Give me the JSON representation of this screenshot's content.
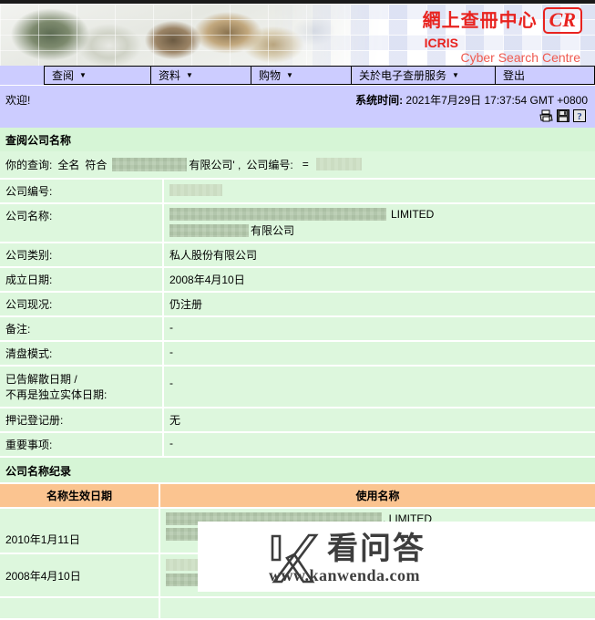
{
  "branding": {
    "logo_cn": "網上查冊中心",
    "logo_mark": "CR",
    "logo_icris": "ICRIS",
    "logo_subtitle": "Cyber Search Centre"
  },
  "menu": {
    "items": [
      {
        "label": "查阅",
        "has_caret": true
      },
      {
        "label": "资料",
        "has_caret": true
      },
      {
        "label": "购物",
        "has_caret": true
      },
      {
        "label": "关於电子查册服务",
        "has_caret": true
      },
      {
        "label": "登出",
        "has_caret": false
      }
    ],
    "caret_glyph": "▼"
  },
  "statusbar": {
    "welcome": "欢迎!",
    "system_time_label": "系统时间:",
    "system_time_value": "2021年7月29日 17:37:54 GMT +0800",
    "icons": [
      "printer-icon",
      "save-icon",
      "help-icon"
    ]
  },
  "query_section": {
    "title": "查阅公司名称",
    "query_lead": "你的查询:",
    "query_mode": "全名",
    "query_match_word": "符合",
    "query_name_redacted": "",
    "query_name_suffix": "有限公司' ,",
    "company_no_label": "公司编号:",
    "equals": "="
  },
  "details": {
    "rows": [
      {
        "label": "公司编号:",
        "value": "",
        "redacted": true
      },
      {
        "label": "公司名称:",
        "value": "LIMITED",
        "value2": "有限公司",
        "redacted": true
      },
      {
        "label": "公司类别:",
        "value": "私人股份有限公司",
        "redacted": false
      },
      {
        "label": "成立日期:",
        "value": "2008年4月10日",
        "redacted": false
      },
      {
        "label": "公司现况:",
        "value": "仍注册",
        "redacted": false
      },
      {
        "label": "备注:",
        "value": "-",
        "redacted": false
      },
      {
        "label": "清盘模式:",
        "value": "-",
        "redacted": false
      },
      {
        "label": "已告解散日期 /",
        "label2": "不再是独立实体日期:",
        "value": "-",
        "redacted": false
      },
      {
        "label": "押记登记册:",
        "value": "无",
        "redacted": false
      },
      {
        "label": "重要事项:",
        "value": "-",
        "redacted": false
      }
    ]
  },
  "history_section": {
    "title": "公司名称纪录",
    "columns": [
      "名称生效日期",
      "使用名称"
    ],
    "rows": [
      {
        "date": "2010年1月11日",
        "name_suffix": ", LIMITED",
        "redacted": true
      },
      {
        "date": "2008年4月10日",
        "name_suffix": "",
        "redacted": true
      }
    ]
  },
  "watermark": {
    "brand_cn": "看问答",
    "url": "www.kanwenda.com"
  },
  "colors": {
    "menu_bg": "#ccccff",
    "content_green": "#ddf7dd",
    "section_green": "#d6f5d6",
    "table_header_orange": "#fbc490",
    "brand_red": "#e8231f",
    "redaction": "#b7ccb0"
  }
}
